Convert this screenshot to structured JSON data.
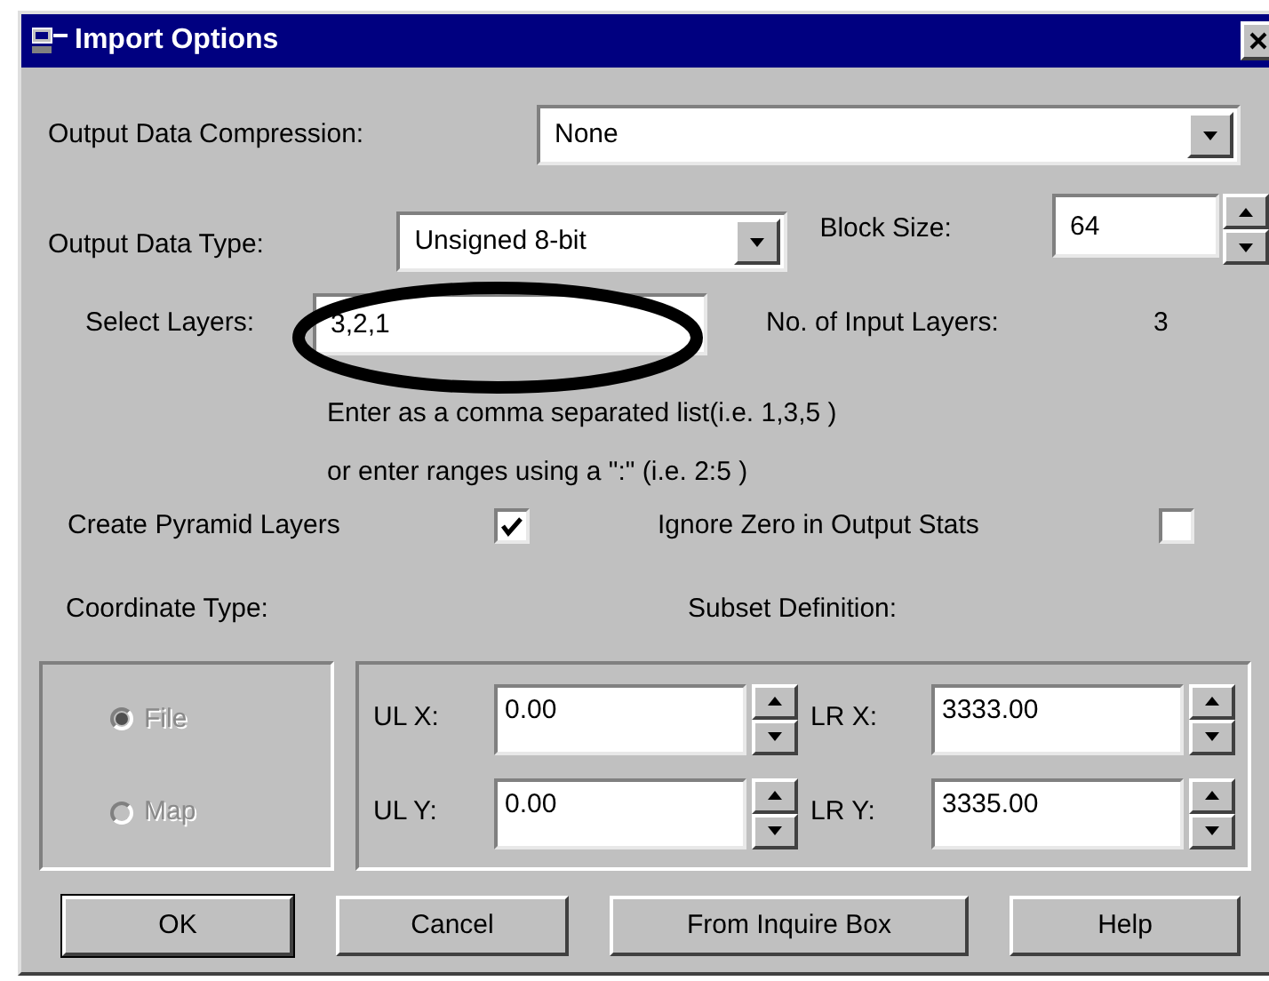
{
  "window": {
    "title": "Import Options"
  },
  "output_data_compression": {
    "label": "Output Data Compression:",
    "value": "None"
  },
  "output_data_type": {
    "label": "Output Data Type:",
    "value": "Unsigned 8-bit"
  },
  "block_size": {
    "label": "Block Size:",
    "value": "64"
  },
  "select_layers": {
    "label": "Select Layers:",
    "value": "3,2,1"
  },
  "input_layers": {
    "label": "No. of Input Layers:",
    "value": "3"
  },
  "hint_lines": [
    "Enter as a comma separated list(i.e. 1,3,5 )",
    "or enter ranges using a \":\" (i.e. 2:5 )"
  ],
  "options": [
    {
      "label": "Create Pyramid Layers",
      "checked": true
    },
    {
      "label": "Ignore Zero in Output Stats",
      "checked": false
    }
  ],
  "coordinate_type": {
    "label": "Coordinate Type:",
    "disabled": true,
    "options": [
      {
        "label": "File",
        "selected": true
      },
      {
        "label": "Map",
        "selected": false
      }
    ]
  },
  "subset_definition": {
    "label": "Subset Definition:",
    "fields": [
      {
        "label": "UL X:",
        "value": "0.00"
      },
      {
        "label": "LR X:",
        "value": "3333.00"
      },
      {
        "label": "UL Y:",
        "value": "0.00"
      },
      {
        "label": "LR Y:",
        "value": "3335.00"
      }
    ]
  },
  "buttons": [
    {
      "label": "OK",
      "default": true
    },
    {
      "label": "Cancel",
      "default": false
    },
    {
      "label": "From Inquire Box",
      "default": false
    },
    {
      "label": "Help",
      "default": false
    }
  ]
}
